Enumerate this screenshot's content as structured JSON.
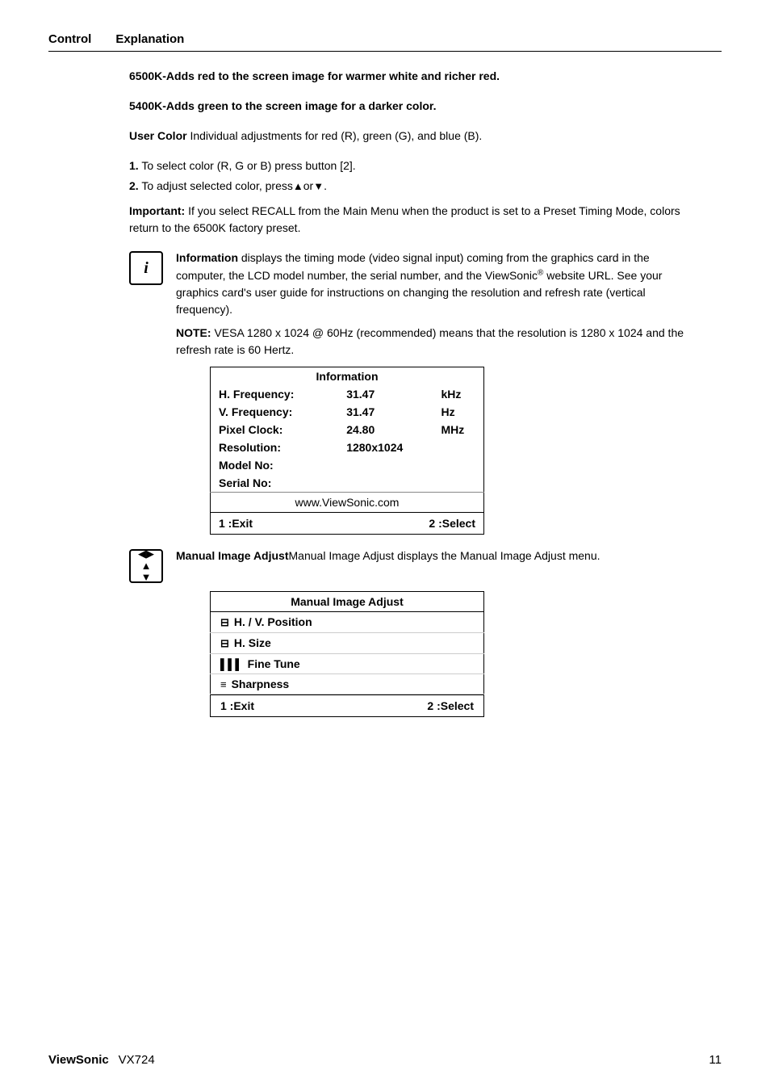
{
  "header": {
    "control_label": "Control",
    "explanation_label": "Explanation"
  },
  "paragraphs": {
    "p6500k": "6500K-Adds red to the screen image for warmer white and richer red.",
    "p5400k": "5400K-Adds green to the screen image for a darker color.",
    "user_color_label": "User Color",
    "user_color_text": " Individual adjustments for red (R), green (G),  and blue (B).",
    "step1": "To select color (R, G or B) press button [2].",
    "step2": "To adjust selected color, press",
    "step2_arrows": "▲or▼",
    "step2_end": ".",
    "important_label": "Important:",
    "important_text": " If you select RECALL from the Main Menu when the product is set to a Preset Timing Mode, colors return to the 6500K factory preset.",
    "info_icon_label": "i",
    "info_para": "Information displays the timing mode (video signal input) coming from the graphics card in the computer, the LCD model number, the serial number, and the ViewSonic® website URL. See your graphics card's user guide for instructions on changing the resolution and refresh rate (vertical frequency).",
    "note_label": "NOTE:",
    "note_text": " VESA 1280 x 1024 @ 60Hz (recommended) means that the resolution is 1280 x 1024 and the refresh rate is 60 Hertz.",
    "manual_para": "Manual Image Adjust displays the Manual Image Adjust menu."
  },
  "info_table": {
    "title": "Information",
    "rows": [
      {
        "label": "H. Frequency:",
        "value1": "31.47",
        "value2": "kHz"
      },
      {
        "label": "V. Frequency:",
        "value1": "31.47",
        "value2": "Hz"
      },
      {
        "label": "Pixel Clock:",
        "value1": "24.80",
        "value2": "MHz"
      },
      {
        "label": "Resolution:",
        "value1": "1280x1024",
        "value2": ""
      },
      {
        "label": "Model No:",
        "value1": "",
        "value2": ""
      },
      {
        "label": "Serial No:",
        "value1": "",
        "value2": ""
      }
    ],
    "website": "www.ViewSonic.com",
    "exit_label": "1 :Exit",
    "select_label": "2 :Select"
  },
  "manual_table": {
    "title": "Manual Image Adjust",
    "items": [
      {
        "icon": "⊟",
        "label": "H. / V. Position"
      },
      {
        "icon": "⊟",
        "label": "H. Size"
      },
      {
        "icon": "▌▌▌",
        "label": "Fine Tune"
      },
      {
        "icon": "≡",
        "label": "Sharpness"
      }
    ],
    "exit_label": "1 :Exit",
    "select_label": "2 :Select"
  },
  "footer": {
    "brand": "ViewSonic",
    "model": "VX724",
    "page_number": "11"
  }
}
